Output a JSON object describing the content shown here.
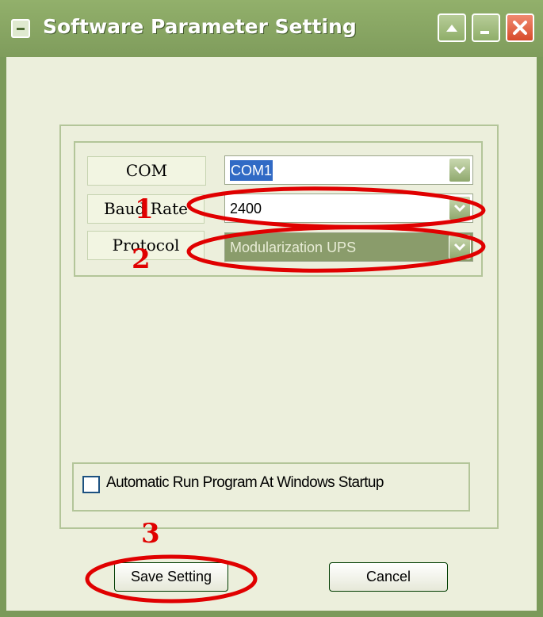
{
  "window": {
    "title": "Software Parameter Setting",
    "controls": [
      "up-button",
      "minimize-button",
      "close-button"
    ]
  },
  "form": {
    "com": {
      "label": "COM",
      "value": "COM1"
    },
    "baud_rate": {
      "label": "Baud Rate",
      "value": "2400"
    },
    "protocol": {
      "label": "Protocol",
      "value": "Modularization UPS"
    }
  },
  "startup": {
    "label": "Automatic Run Program At Windows Startup",
    "checked": false
  },
  "buttons": {
    "save_label": "Save Setting",
    "cancel_label": "Cancel"
  },
  "annotations": {
    "markers": [
      "1",
      "2",
      "3"
    ],
    "color": "#e00000"
  },
  "theme": {
    "title_bar": "#7f9c5c",
    "client_bg": "#ecefdc",
    "selection": "#316ac5"
  }
}
